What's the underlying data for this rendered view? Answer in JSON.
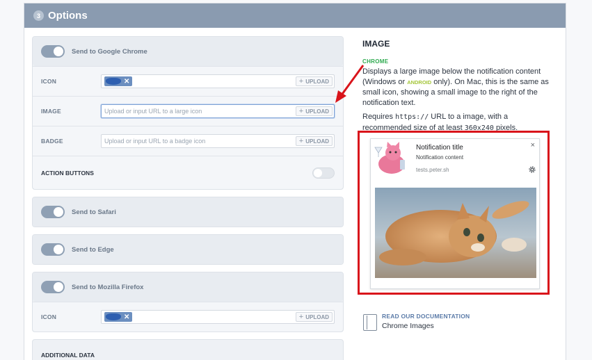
{
  "header": {
    "step": "3",
    "title": "Options"
  },
  "chrome_group": {
    "label": "Send to Google Chrome",
    "rows": {
      "icon": {
        "label": "ICON",
        "upload": "UPLOAD"
      },
      "image": {
        "label": "IMAGE",
        "placeholder": "Upload or input URL to a large icon",
        "upload": "UPLOAD"
      },
      "badge": {
        "label": "BADGE",
        "placeholder": "Upload or input URL to a badge icon",
        "upload": "UPLOAD"
      },
      "action_buttons": {
        "label": "ACTION BUTTONS"
      }
    }
  },
  "safari_group": {
    "label": "Send to Safari"
  },
  "edge_group": {
    "label": "Send to Edge"
  },
  "firefox_group": {
    "label": "Send to Mozilla Firefox",
    "icon_row": {
      "label": "ICON",
      "upload": "UPLOAD"
    }
  },
  "additional_data": {
    "label": "ADDITIONAL DATA"
  },
  "help": {
    "title": "IMAGE",
    "badge": "CHROME",
    "desc_1": "Displays a large image below the notification content (Windows or ",
    "desc_android": "ANDROID",
    "desc_2": " only). On Mac, this is the same as small icon, showing a small image to the right of the notification text.",
    "req_1": "Requires ",
    "req_code": "https://",
    "req_2": " URL to a image, with a recommended size of at least ",
    "req_size": "360x240",
    "req_3": " pixels."
  },
  "notification": {
    "title": "Notification title",
    "content": "Notification content",
    "site": "tests.peter.sh",
    "close": "×"
  },
  "docs": {
    "title": "READ OUR DOCUMENTATION",
    "subtitle": "Chrome Images"
  },
  "colors": {
    "header": "#8a9bb0",
    "accent_red": "#d9141b",
    "chrome_green": "#2eaa4f",
    "android_green": "#a4c639",
    "link": "#5b7ba8"
  },
  "icons": [
    "upload-plus-icon",
    "close-icon",
    "gear-icon",
    "document-icon",
    "arrow-icon"
  ]
}
